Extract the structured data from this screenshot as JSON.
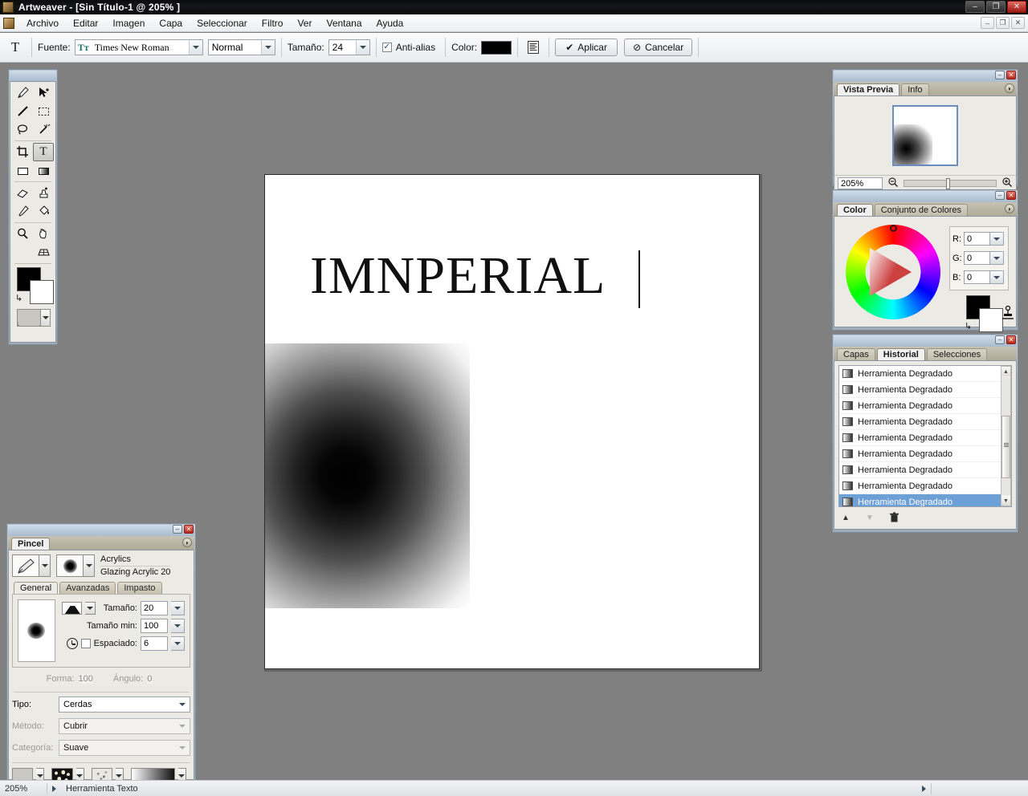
{
  "window": {
    "title": "Artweaver - [Sin Título-1 @ 205% ]",
    "app_icon": "artweaver-icon",
    "controls": {
      "minimize": "–",
      "maximize": "❐",
      "close": "✕"
    }
  },
  "menubar": {
    "doc_icon": "document-icon",
    "items": [
      "Archivo",
      "Editar",
      "Imagen",
      "Capa",
      "Seleccionar",
      "Filtro",
      "Ver",
      "Ventana",
      "Ayuda"
    ],
    "doc_controls": {
      "minimize": "–",
      "restore": "❐",
      "close": "✕"
    }
  },
  "options_bar": {
    "tool_glyph": "T",
    "font_label": "Fuente:",
    "font_value": "Times New Roman",
    "font_icon_glyph": "Tт",
    "style_value": "Normal",
    "size_label": "Tamaño:",
    "size_value": "24",
    "antialias_label": "Anti-alias",
    "antialias_checked": "✓",
    "color_label": "Color:",
    "color_value": "#000000",
    "align_icon": "text-align-icon",
    "apply_label": "Aplicar",
    "apply_glyph": "✔",
    "cancel_label": "Cancelar",
    "cancel_glyph": "⊘"
  },
  "tool_palette": {
    "tools": [
      {
        "name": "brush-tool",
        "glyph": "🖌"
      },
      {
        "name": "move-tool",
        "glyph": "➤"
      },
      {
        "name": "line-tool",
        "glyph": "╱"
      },
      {
        "name": "rect-select-tool",
        "glyph": "▭"
      },
      {
        "name": "lasso-tool",
        "glyph": "◯"
      },
      {
        "name": "magic-wand-tool",
        "glyph": "✳"
      },
      {
        "name": "crop-tool",
        "glyph": "⌗"
      },
      {
        "name": "text-tool",
        "glyph": "T"
      },
      {
        "name": "shape-tool",
        "glyph": "▢"
      },
      {
        "name": "gradient-tool",
        "glyph": "▦"
      },
      {
        "name": "eraser-tool",
        "glyph": "▱"
      },
      {
        "name": "clone-stamp-tool",
        "glyph": "⎙"
      },
      {
        "name": "eyedropper-tool",
        "glyph": "⚲"
      },
      {
        "name": "paint-bucket-tool",
        "glyph": "⬗"
      },
      {
        "name": "zoom-tool",
        "glyph": "⚲"
      },
      {
        "name": "hand-tool",
        "glyph": "✋"
      },
      {
        "name": "perspective-tool",
        "glyph": "▦"
      }
    ],
    "selected_tool": "text-tool",
    "foreground_color": "#000000",
    "background_color": "#ffffff",
    "swap_icon": "swap-colors-icon",
    "texture_icon": "texture-swatch-icon"
  },
  "preview_panel": {
    "tabs": [
      {
        "label": "Vista Previa",
        "active": true
      },
      {
        "label": "Info",
        "active": false
      }
    ],
    "zoom_value": "205%",
    "zoom_out_icon": "zoom-out-icon",
    "zoom_in_icon": "zoom-in-icon",
    "menu_icon": "panel-menu-icon",
    "minimize_glyph": "–",
    "close_glyph": "✕"
  },
  "color_panel": {
    "tabs": [
      {
        "label": "Color",
        "active": true
      },
      {
        "label": "Conjunto de Colores",
        "active": false
      }
    ],
    "channels": [
      {
        "key": "R:",
        "value": "0"
      },
      {
        "key": "G:",
        "value": "0"
      },
      {
        "key": "B:",
        "value": "0"
      }
    ],
    "foreground_color": "#000000",
    "background_color": "#ffffff",
    "wheel_icon": "color-wheel-icon",
    "swap_icon": "swap-colors-icon",
    "picker_icon": "color-picker-icon",
    "menu_icon": "panel-menu-icon",
    "minimize_glyph": "–",
    "close_glyph": "✕"
  },
  "history_panel": {
    "tabs": [
      {
        "label": "Capas",
        "active": false
      },
      {
        "label": "Historial",
        "active": true
      },
      {
        "label": "Selecciones",
        "active": false
      }
    ],
    "entries": [
      {
        "label": "Herramienta Degradado",
        "selected": false
      },
      {
        "label": "Herramienta Degradado",
        "selected": false
      },
      {
        "label": "Herramienta Degradado",
        "selected": false
      },
      {
        "label": "Herramienta Degradado",
        "selected": false
      },
      {
        "label": "Herramienta Degradado",
        "selected": false
      },
      {
        "label": "Herramienta Degradado",
        "selected": false
      },
      {
        "label": "Herramienta Degradado",
        "selected": false
      },
      {
        "label": "Herramienta Degradado",
        "selected": false
      },
      {
        "label": "Herramienta Degradado",
        "selected": true
      }
    ],
    "footer": {
      "up_icon": "move-up-icon",
      "down_icon": "move-down-icon",
      "delete_icon": "trash-icon"
    },
    "selection_color": "#6ea0d8",
    "minimize_glyph": "–",
    "close_glyph": "✕"
  },
  "brush_panel": {
    "tabs": [
      {
        "label": "Pincel",
        "active": true
      }
    ],
    "brush_category": "Acrylics",
    "brush_name": "Glazing Acrylic 20",
    "sub_tabs": [
      {
        "label": "General",
        "active": true
      },
      {
        "label": "Avanzadas",
        "active": false
      },
      {
        "label": "Impasto",
        "active": false
      }
    ],
    "fields": [
      {
        "label": "Tamaño:",
        "value": "20",
        "disabled": false
      },
      {
        "label": "Tamaño min:",
        "value": "100",
        "disabled": false
      },
      {
        "label": "Espaciado:",
        "value": "6",
        "disabled": false
      }
    ],
    "shape_label": "Forma:",
    "shape_value": "100",
    "angle_label": "Ángulo:",
    "angle_value": "0",
    "selects": [
      {
        "label": "Tipo:",
        "value": "Cerdas",
        "disabled": false
      },
      {
        "label": "Método:",
        "value": "Cubrir",
        "disabled": true
      },
      {
        "label": "Categoría:",
        "value": "Suave",
        "disabled": true
      }
    ],
    "footer_swatches": [
      "texture-crack-swatch",
      "pattern-dots-swatch",
      "noise-swatch",
      "gradient-swatch"
    ],
    "menu_icon": "panel-menu-icon",
    "minimize_glyph": "–",
    "close_glyph": "✕"
  },
  "canvas": {
    "text_content": "IMNPERIAL",
    "caret_visible": true,
    "gradient_blob": "radial-black-gradient"
  },
  "statusbar": {
    "zoom": "205%",
    "tool_name": "Herramienta Texto",
    "expand_glyph": "▸"
  }
}
